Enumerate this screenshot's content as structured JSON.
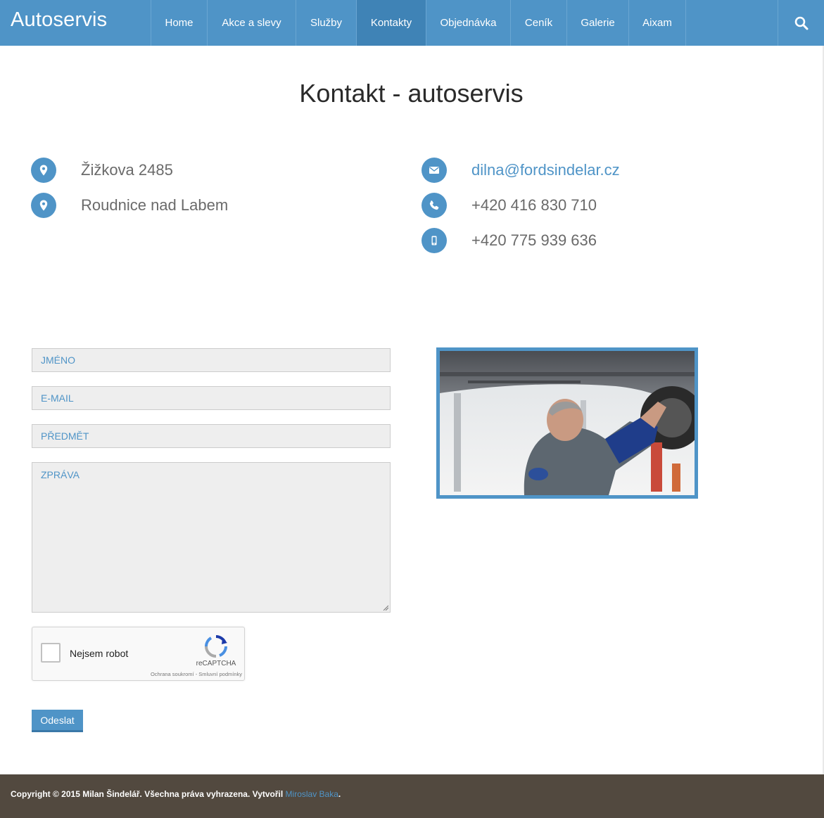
{
  "navbar": {
    "brand": "Autoservis",
    "items": [
      {
        "label": "Home",
        "active": false
      },
      {
        "label": "Akce a slevy",
        "active": false
      },
      {
        "label": "Služby",
        "active": false
      },
      {
        "label": "Kontakty",
        "active": true
      },
      {
        "label": "Objednávka",
        "active": false
      },
      {
        "label": "Ceník",
        "active": false
      },
      {
        "label": "Galerie",
        "active": false
      },
      {
        "label": "Aixam",
        "active": false
      }
    ],
    "search_icon": "search-icon"
  },
  "page": {
    "title": "Kontakt - autoservis"
  },
  "contact": {
    "address_line1": "Žižkova 2485",
    "address_line2": "Roudnice nad Labem",
    "email": "dilna@fordsindelar.cz",
    "phone": "+420 416 830 710",
    "mobile": "+420 775 939 636",
    "icons": [
      "map-marker-icon",
      "map-marker-icon",
      "envelope-icon",
      "phone-icon",
      "mobile-icon"
    ]
  },
  "form": {
    "name_placeholder": "JMÉNO",
    "email_placeholder": "E-MAIL",
    "subject_placeholder": "PŘEDMĚT",
    "message_placeholder": "ZPRÁVA",
    "captcha": {
      "label": "Nejsem robot",
      "brand": "reCAPTCHA",
      "terms": "Ochrana soukromí - Smluvní podmínky"
    },
    "submit_label": "Odeslat"
  },
  "footer": {
    "copyright": "Copyright © 2015 Milan Šindelář. Všechna práva vyhrazena. Vytvořil ",
    "author": "Miroslav Baka",
    "suffix": "."
  },
  "colors": {
    "accent": "#4f94c7",
    "nav_active": "#3f83b6",
    "footer_bg": "#52493f"
  }
}
